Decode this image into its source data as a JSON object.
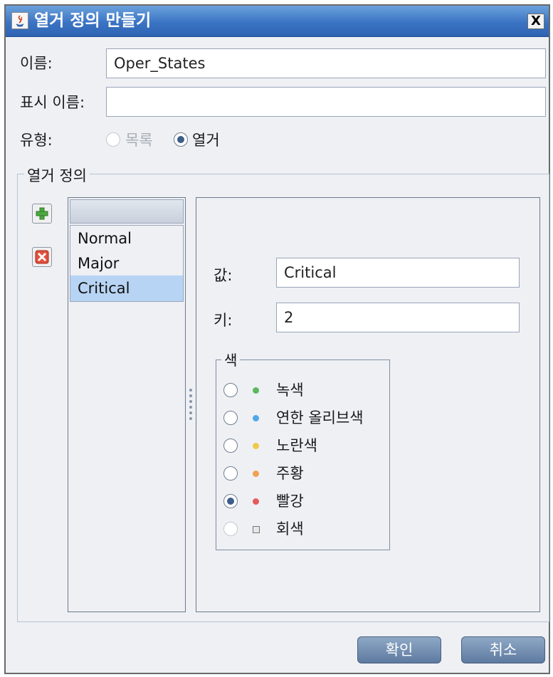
{
  "window": {
    "title": "열거 정의 만들기",
    "close_label": "X"
  },
  "form": {
    "name_label": "이름:",
    "name_value": "Oper_States",
    "display_name_label": "표시 이름:",
    "display_name_value": "",
    "type_label": "유형:",
    "type_options": [
      {
        "label": "목록",
        "checked": false,
        "enabled": false
      },
      {
        "label": "열거",
        "checked": true,
        "enabled": true
      }
    ]
  },
  "enum_group": {
    "title": "열거 정의",
    "items": [
      "Normal",
      "Major",
      "Critical"
    ],
    "selected_index": 2,
    "value_label": "값:",
    "value": "Critical",
    "key_label": "키:",
    "key": "2",
    "color_group": {
      "title": "색",
      "options": [
        {
          "label": "녹색",
          "color": "#5cb85c",
          "checked": false,
          "enabled": true
        },
        {
          "label": "연한 올리브색",
          "color": "#4fa8e8",
          "checked": false,
          "enabled": true
        },
        {
          "label": "노란색",
          "color": "#f0c94a",
          "checked": false,
          "enabled": true
        },
        {
          "label": "주황",
          "color": "#f0a050",
          "checked": false,
          "enabled": true
        },
        {
          "label": "빨강",
          "color": "#e85a5a",
          "checked": true,
          "enabled": true
        },
        {
          "label": "회색",
          "color": "#9a9a9a",
          "checked": false,
          "enabled": false
        }
      ]
    }
  },
  "buttons": {
    "ok": "확인",
    "cancel": "취소"
  },
  "icons": [
    "java-icon",
    "close-icon",
    "add-icon",
    "delete-icon"
  ]
}
